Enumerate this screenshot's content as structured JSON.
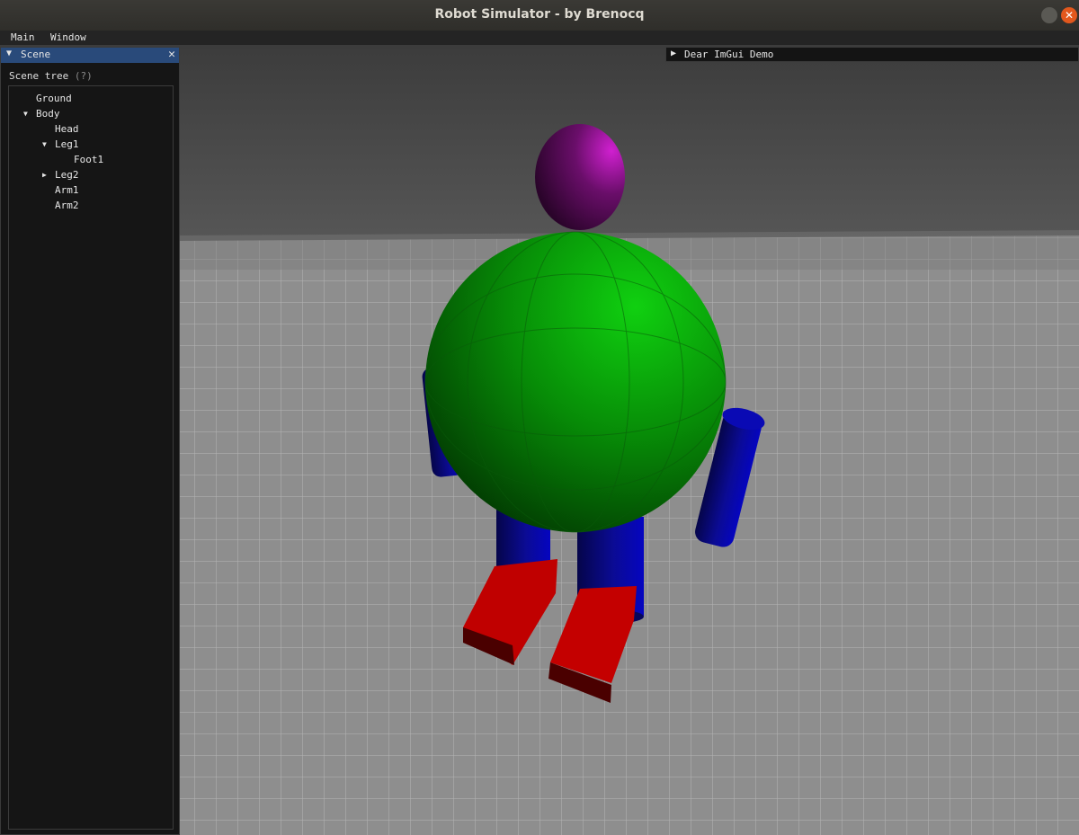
{
  "window": {
    "title": "Robot Simulator - by Brenocq"
  },
  "menu": {
    "items": [
      "Main",
      "Window"
    ]
  },
  "scene_panel": {
    "title": "Scene",
    "close_glyph": "✕",
    "collapse_glyph": "▼",
    "tree_label": "Scene tree",
    "help_marker": "(?)",
    "tree": [
      {
        "label": "Ground",
        "toggle": ""
      },
      {
        "label": "Body",
        "toggle": "▼"
      },
      {
        "label": "Head",
        "toggle": ""
      },
      {
        "label": "Leg1",
        "toggle": "▼"
      },
      {
        "label": "Foot1",
        "toggle": ""
      },
      {
        "label": "Leg2",
        "toggle": "▶"
      },
      {
        "label": "Arm1",
        "toggle": ""
      },
      {
        "label": "Arm2",
        "toggle": ""
      }
    ]
  },
  "demo_window": {
    "title": "Dear ImGui Demo",
    "collapse_glyph": "▶"
  },
  "colors": {
    "body": "#0a8a0a",
    "head": "#b010b0",
    "limbs": "#0a0a90",
    "feet": "#a00000",
    "ground": "#8c8c8c",
    "sky": "#4a4a4a",
    "panel_title": "#294a7a"
  }
}
